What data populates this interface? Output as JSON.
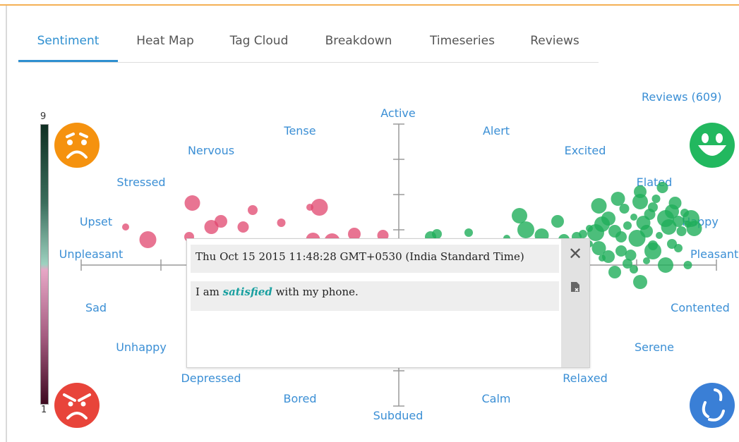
{
  "tabs": [
    "Sentiment",
    "Heat Map",
    "Tag Cloud",
    "Breakdown",
    "Timeseries",
    "Reviews"
  ],
  "active_tab": "Sentiment",
  "reviews_count": "Reviews (609)",
  "legend": {
    "max": "9",
    "min": "1"
  },
  "moods": {
    "active": "Active",
    "tense": "Tense",
    "alert": "Alert",
    "nervous": "Nervous",
    "excited": "Excited",
    "stressed": "Stressed",
    "elated": "Elated",
    "upset": "Upset",
    "happy": "Happy",
    "unpleasant": "Unpleasant",
    "pleasant": "Pleasant",
    "sad": "Sad",
    "contented": "Contented",
    "unhappy": "Unhappy",
    "serene": "Serene",
    "depressed": "Depressed",
    "relaxed": "Relaxed",
    "bored": "Bored",
    "calm": "Calm",
    "subdued": "Subdued"
  },
  "popup": {
    "date": "Thu Oct 15 2015 11:48:28 GMT+0530 (India Standard Time)",
    "text_before": "I am ",
    "keyword": "satisfied",
    "text_after": " with my phone."
  },
  "icons": {
    "top_left": "sad-face-icon",
    "top_right": "happy-face-icon",
    "bottom_left": "angry-face-icon",
    "bottom_right": "calm-face-icon",
    "close": "close-icon",
    "document": "document-icon"
  },
  "colors": {
    "accent": "#2e8fd0",
    "label": "#3b8fd5",
    "negative": "#e0456e",
    "positive": "#1fae5a",
    "sad_face": "#f5920f",
    "happy_face": "#22b85f",
    "angry_face": "#e8443a",
    "calm_face": "#3a7fd6",
    "top_border": "#f4b155"
  },
  "chart_data": {
    "type": "scatter",
    "xlabel": "",
    "ylabel": "",
    "xlim": [
      -1,
      1
    ],
    "ylim": [
      -1,
      1
    ],
    "grid": false,
    "series": [
      {
        "points": [
          [
            -0.86,
            0.27
          ],
          [
            -0.79,
            0.18
          ],
          [
            -0.65,
            0.44
          ],
          [
            -0.59,
            0.27
          ],
          [
            -0.56,
            0.31
          ],
          [
            -0.49,
            0.27
          ],
          [
            -0.46,
            0.39
          ],
          [
            -0.37,
            0.3
          ],
          [
            -0.28,
            0.41
          ],
          [
            -0.25,
            0.41
          ],
          [
            -0.21,
            0.17
          ],
          [
            -0.27,
            0.18
          ],
          [
            -0.14,
            0.22
          ],
          [
            -0.05,
            0.21
          ],
          [
            -0.66,
            0.2
          ],
          [
            -0.61,
            0.13
          ]
        ]
      },
      {
        "points": [
          [
            0.1,
            0.2
          ],
          [
            0.12,
            0.22
          ],
          [
            0.22,
            0.23
          ],
          [
            0.34,
            0.19
          ],
          [
            0.4,
            0.25
          ],
          [
            0.38,
            0.35
          ],
          [
            0.45,
            0.21
          ],
          [
            0.5,
            0.31
          ],
          [
            0.52,
            0.18
          ],
          [
            0.56,
            0.2
          ],
          [
            0.58,
            0.22
          ],
          [
            0.6,
            0.26
          ],
          [
            0.62,
            0.23
          ],
          [
            0.64,
            0.29
          ],
          [
            0.66,
            0.33
          ],
          [
            0.68,
            0.24
          ],
          [
            0.7,
            0.2
          ],
          [
            0.71,
            0.4
          ],
          [
            0.72,
            0.28
          ],
          [
            0.74,
            0.34
          ],
          [
            0.75,
            0.19
          ],
          [
            0.76,
            0.45
          ],
          [
            0.77,
            0.3
          ],
          [
            0.78,
            0.24
          ],
          [
            0.79,
            0.36
          ],
          [
            0.8,
            0.41
          ],
          [
            0.81,
            0.47
          ],
          [
            0.82,
            0.21
          ],
          [
            0.84,
            0.33
          ],
          [
            0.85,
            0.27
          ],
          [
            0.86,
            0.38
          ],
          [
            0.87,
            0.44
          ],
          [
            0.88,
            0.31
          ],
          [
            0.89,
            0.24
          ],
          [
            0.9,
            0.37
          ],
          [
            0.91,
            0.29
          ],
          [
            0.92,
            0.33
          ],
          [
            0.93,
            0.26
          ],
          [
            0.63,
            0.12
          ],
          [
            0.66,
            0.06
          ],
          [
            0.7,
            0.1
          ],
          [
            0.72,
            0.01
          ],
          [
            0.74,
            -0.03
          ],
          [
            0.78,
            0.03
          ],
          [
            0.8,
            0.1
          ],
          [
            0.84,
            0.0
          ],
          [
            0.76,
            -0.12
          ],
          [
            0.68,
            -0.05
          ],
          [
            0.73,
            0.07
          ],
          [
            0.86,
            0.15
          ],
          [
            0.91,
            0.0
          ],
          [
            0.6,
            0.15
          ],
          [
            0.57,
            0.12
          ],
          [
            0.63,
            0.42
          ],
          [
            0.69,
            0.47
          ],
          [
            0.76,
            0.52
          ],
          [
            0.83,
            0.55
          ],
          [
            0.8,
            0.14
          ],
          [
            0.88,
            0.12
          ],
          [
            0.64,
            0.05
          ]
        ]
      }
    ]
  }
}
